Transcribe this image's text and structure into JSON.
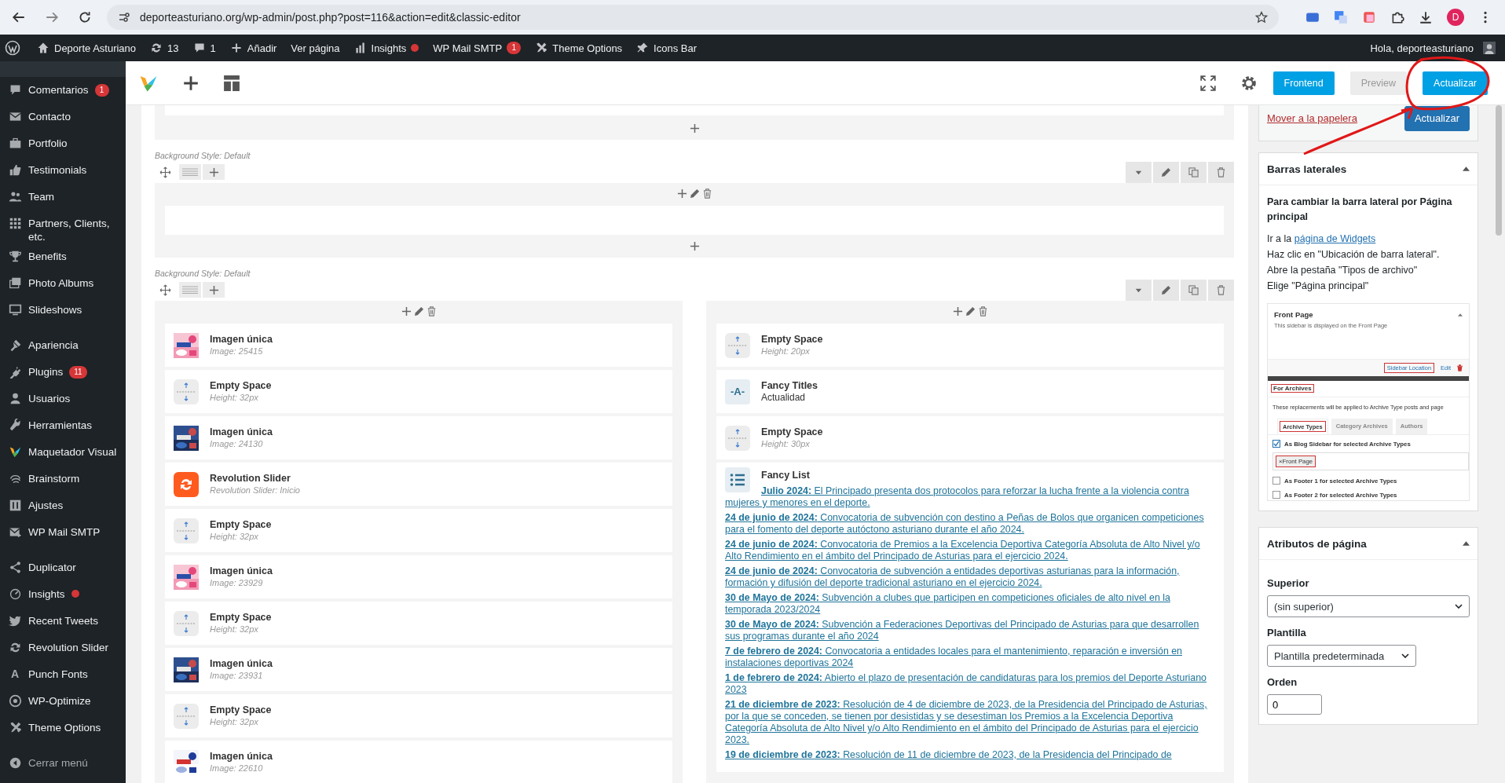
{
  "browser": {
    "url": "deporteasturiano.org/wp-admin/post.php?post=116&action=edit&classic-editor",
    "profile_initial": "D"
  },
  "admin_bar": {
    "site": "Deporte Asturiano",
    "updates": "13",
    "comments": "1",
    "items": [
      {
        "label": "Añadir"
      },
      {
        "label": "Ver página"
      },
      {
        "label": "Insights",
        "dot": true
      },
      {
        "label": "WP Mail SMTP",
        "badge": "1"
      },
      {
        "label": "Theme Options"
      },
      {
        "label": "Icons Bar"
      }
    ],
    "greeting": "Hola, deporteasturiano"
  },
  "sidebar": {
    "groups": [
      {
        "items": [
          {
            "label": "Comentarios",
            "badge": "1"
          },
          {
            "label": "Contacto"
          },
          {
            "label": "Portfolio"
          },
          {
            "label": "Testimonials"
          },
          {
            "label": "Team"
          },
          {
            "label": "Partners, Clients, etc."
          },
          {
            "label": "Benefits"
          },
          {
            "label": "Photo Albums"
          },
          {
            "label": "Slideshows"
          }
        ]
      },
      {
        "items": [
          {
            "label": "Apariencia"
          },
          {
            "label": "Plugins",
            "badge": "11"
          },
          {
            "label": "Usuarios"
          },
          {
            "label": "Herramientas"
          },
          {
            "label": "Maquetador Visual"
          },
          {
            "label": "Brainstorm"
          },
          {
            "label": "Ajustes"
          },
          {
            "label": "WP Mail SMTP"
          }
        ]
      },
      {
        "items": [
          {
            "label": "Duplicator"
          },
          {
            "label": "Insights",
            "dot": true
          },
          {
            "label": "Recent Tweets"
          },
          {
            "label": "Revolution Slider"
          },
          {
            "label": "Punch Fonts",
            "glyph": "A"
          },
          {
            "label": "WP-Optimize"
          },
          {
            "label": "Theme Options"
          }
        ]
      }
    ],
    "collapse": "Cerrar menú"
  },
  "builder_toolbar": {
    "buttons": [
      {
        "label": "Frontend",
        "kind": "primary"
      },
      {
        "label": "Preview",
        "kind": "secondary"
      },
      {
        "label": "Actualizar",
        "kind": "primary"
      }
    ]
  },
  "editor": {
    "rows": [
      {
        "background_style": "Background Style: Default",
        "columns": [
          {}
        ]
      },
      {
        "background_style": "Background Style: Default",
        "columns": [
          {
            "elements": [
              {
                "title": "Imagen única",
                "detail": "Image: 25415"
              },
              {
                "kind": "space",
                "title": "Empty Space",
                "detail": "Height: 32px"
              },
              {
                "title": "Imagen única",
                "detail": "Image: 24130"
              },
              {
                "kind": "slider",
                "title": "Revolution Slider",
                "detail": "Revolution Slider: Inicio"
              },
              {
                "kind": "space",
                "title": "Empty Space",
                "detail": "Height: 32px"
              },
              {
                "title": "Imagen única",
                "detail": "Image: 23929"
              },
              {
                "kind": "space",
                "title": "Empty Space",
                "detail": "Height: 32px"
              },
              {
                "title": "Imagen única",
                "detail": "Image: 23931"
              },
              {
                "kind": "space",
                "title": "Empty Space",
                "detail": "Height: 32px"
              },
              {
                "title": "Imagen única",
                "detail": "Image: 22610"
              }
            ]
          },
          {
            "elements": [
              {
                "kind": "space",
                "title": "Empty Space",
                "detail": "Height: 20px"
              },
              {
                "kind": "titles",
                "title": "Fancy Titles",
                "detail": "Actualidad",
                "icon_text": "-A-"
              },
              {
                "kind": "space",
                "title": "Empty Space",
                "detail": "Height: 30px"
              },
              {
                "kind": "list",
                "title": "Fancy List",
                "links": [
                  {
                    "date": "Julio 2024:",
                    "text": " El Principado presenta dos protocolos para reforzar la lucha frente a la violencia contra mujeres y menores en el deporte."
                  },
                  {
                    "date": "24 de junio de 2024:",
                    "text": " Convocatoria de subvención con destino a Peñas de Bolos que organicen competiciones para el fomento del deporte autóctono asturiano durante el año 2024."
                  },
                  {
                    "date": "24 de junio de 2024:",
                    "text": " Convocatoria de Premios a la Excelencia Deportiva Categoría Absoluta de Alto Nivel y/o Alto Rendimiento en el ámbito del Principado de Asturias para el ejercicio 2024."
                  },
                  {
                    "date": "24 de junio de 2024:",
                    "text": " Convocatoria de subvención a entidades deportivas asturianas para la información, formación y difusión del deporte tradicional asturiano en el ejercicio 2024."
                  },
                  {
                    "date": "30 de Mayo de 2024:",
                    "text": " Subvención a clubes que participen en competiciones oficiales de alto nivel en la temporada 2023/2024"
                  },
                  {
                    "date": "30 de Mayo de 2024:",
                    "text": " Subvención a Federaciones Deportivas del Principado de Asturias para que desarrollen sus programas durante el año 2024"
                  },
                  {
                    "date": "7 de febrero de 2024:",
                    "text": " Convocatoria a entidades locales para el mantenimiento, reparación e inversión en instalaciones deportivas 2024"
                  },
                  {
                    "date": "1 de febrero de 2024:",
                    "text": " Abierto el plazo de presentación de candidaturas para los premios del Deporte Asturiano 2023"
                  },
                  {
                    "date": "21 de diciembre de 2023:",
                    "text": " Resolución de 4 de diciembre de 2023, de la Presidencia del Principado de Asturias, por la que se conceden, se tienen por desistidas y se desestiman los Premios a la Excelencia Deportiva Categoría Absoluta de Alto Nivel y/o Alto Rendimiento en el ámbito del Principado de Asturias para el ejercicio 2023."
                  },
                  {
                    "date": "19 de diciembre de 2023:",
                    "text": " Resolución de 11 de diciembre de 2023, de la Presidencia del Principado de"
                  }
                ]
              }
            ]
          }
        ]
      }
    ]
  },
  "publish": {
    "trash_link": "Mover a la papelera",
    "button": "Actualizar"
  },
  "sidebars_box": {
    "title": "Barras laterales",
    "intro": "Para cambiar la barra lateral por Página principal",
    "steps": [
      {
        "text": "Ir a la ",
        "link": "página de Widgets"
      },
      {
        "text": "Haz clic en \"Ubicación de barra lateral\"."
      },
      {
        "text": "Abre la pestaña \"Tipos de archivo\""
      },
      {
        "text": "Elige \"Página principal\""
      }
    ],
    "preview": {
      "widget_title": "Front Page",
      "widget_desc": "This sidebar is displayed on the Front Page",
      "location_button": "Sidebar Location",
      "edit_link": "Edit",
      "section": "For Archives",
      "section_desc": "These replacements will be applied to Archive Type posts and page",
      "tabs": [
        {
          "label": "Archive Types",
          "selected": true
        },
        {
          "label": "Category Archives",
          "selected": false
        },
        {
          "label": "Authors",
          "selected": false
        }
      ],
      "options": [
        {
          "label": "As Blog Sidebar for selected Archive Types",
          "checked": true,
          "tag": "×Front Page"
        },
        {
          "label": "As Footer 1 for selected Archive Types",
          "checked": false
        },
        {
          "label": "As Footer 2 for selected Archive Types",
          "checked": false
        }
      ]
    }
  },
  "attributes_box": {
    "title": "Atributos de página",
    "fields": [
      {
        "label": "Superior",
        "kind": "select",
        "value": "(sin superior)"
      },
      {
        "label": "Plantilla",
        "kind": "select",
        "value": "Plantilla predeterminada"
      },
      {
        "label": "Orden",
        "kind": "number",
        "value": "0"
      }
    ]
  }
}
